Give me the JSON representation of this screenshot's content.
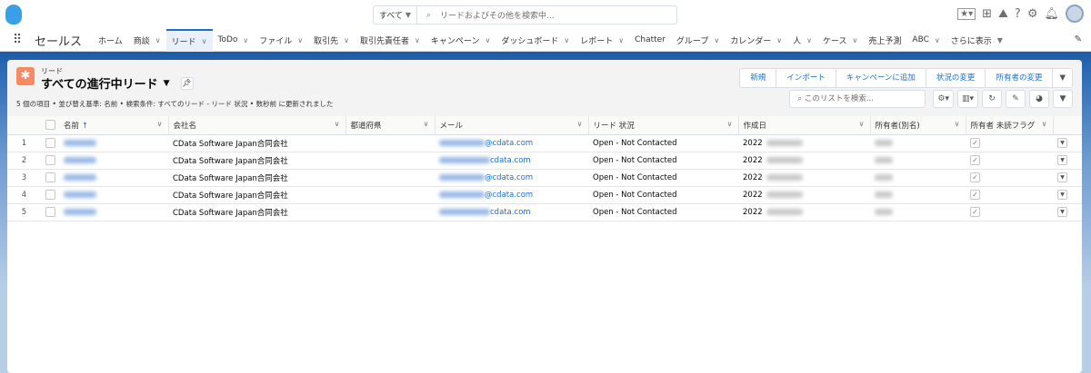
{
  "header": {
    "search_scope": "すべて",
    "search_placeholder": "リードおよびその他を検索中...",
    "icons": [
      "favorites-icon",
      "add-icon",
      "trailhead-icon",
      "help-icon",
      "setup-gear-icon",
      "notification-bell-icon",
      "avatar"
    ]
  },
  "nav": {
    "app_name": "セールス",
    "items": [
      {
        "label": "ホーム",
        "chevron": false
      },
      {
        "label": "商談",
        "chevron": true
      },
      {
        "label": "リード",
        "chevron": true,
        "active": true
      },
      {
        "label": "ToDo",
        "chevron": true
      },
      {
        "label": "ファイル",
        "chevron": true
      },
      {
        "label": "取引先",
        "chevron": true
      },
      {
        "label": "取引先責任者",
        "chevron": true
      },
      {
        "label": "キャンペーン",
        "chevron": true
      },
      {
        "label": "ダッシュボード",
        "chevron": true
      },
      {
        "label": "レポート",
        "chevron": true
      },
      {
        "label": "Chatter",
        "chevron": false
      },
      {
        "label": "グループ",
        "chevron": true
      },
      {
        "label": "カレンダー",
        "chevron": true
      },
      {
        "label": "人",
        "chevron": true
      },
      {
        "label": "ケース",
        "chevron": true
      },
      {
        "label": "売上予測",
        "chevron": false
      },
      {
        "label": "ABC",
        "chevron": true
      }
    ],
    "more": "さらに表示"
  },
  "list": {
    "object": "リード",
    "view_title": "すべての進行中リード",
    "meta": "5 個の項目 • 並び替え基準: 名前 • 検索条件: すべてのリード - リード 状況 • 数秒前 に更新されました",
    "buttons": [
      "新規",
      "インポート",
      "キャンペーンに追加",
      "状況の変更",
      "所有者の変更"
    ],
    "search_placeholder": "このリストを検索...",
    "columns": [
      "名前",
      "会社名",
      "都道府県",
      "メール",
      "リード 状況",
      "作成日",
      "所有者(別名)",
      "所有者 未読フラグ"
    ],
    "sort_indicator": "↑",
    "rows": [
      {
        "num": "1",
        "company": "CData Software Japan合同会社",
        "email_suffix": "@cdata.com",
        "status": "Open - Not Contacted",
        "created": "2022",
        "unread": true
      },
      {
        "num": "2",
        "company": "CData Software Japan合同会社",
        "email_suffix": "cdata.com",
        "status": "Open - Not Contacted",
        "created": "2022",
        "unread": true
      },
      {
        "num": "3",
        "company": "CData Software Japan合同会社",
        "email_suffix": "@cdata.com",
        "status": "Open - Not Contacted",
        "created": "2022",
        "unread": true
      },
      {
        "num": "4",
        "company": "CData Software Japan合同会社",
        "email_suffix": "@cdata.com",
        "status": "Open - Not Contacted",
        "created": "2022",
        "unread": true
      },
      {
        "num": "5",
        "company": "CData Software Japan合同会社",
        "email_suffix": "cdata.com",
        "status": "Open - Not Contacted",
        "created": "2022",
        "unread": true
      }
    ]
  }
}
